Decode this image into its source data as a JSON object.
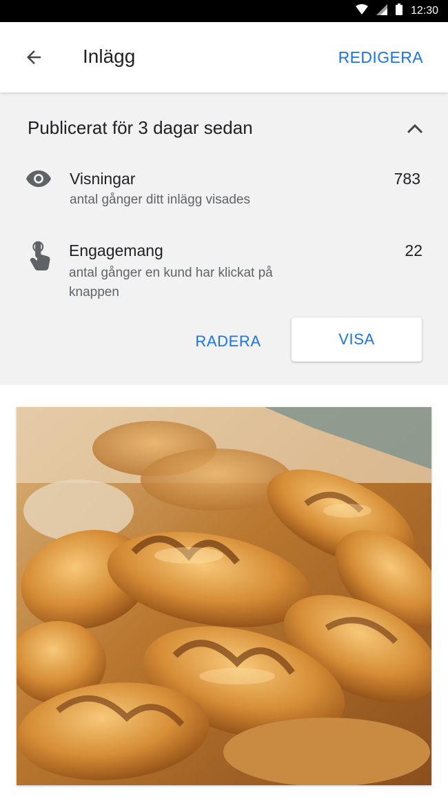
{
  "status_bar": {
    "time": "12:30",
    "icons": [
      "wifi-icon",
      "cell-signal-icon",
      "battery-icon"
    ]
  },
  "app_bar": {
    "back_icon": "arrow-back-icon",
    "title": "Inlägg",
    "edit_label": "REDIGERA"
  },
  "post_info": {
    "published": "Publicerat för 3 dagar sedan",
    "collapse_icon": "chevron-up-icon",
    "stats": [
      {
        "icon": "eye-icon",
        "title": "Visningar",
        "description": "antal gånger ditt inlägg visades",
        "value": "783"
      },
      {
        "icon": "touch-hand-icon",
        "title": "Engagemang",
        "description_line1": "antal gånger en kund har klickat på",
        "description_line2": "knappen",
        "value": "22"
      }
    ],
    "actions": {
      "delete_label": "RADERA",
      "view_label": "VISA"
    }
  },
  "post_image": {
    "subject": "croissants-photo"
  },
  "colors": {
    "accent": "#1a73e8",
    "panel_background": "#f2f2f2",
    "status_bar": "#000000"
  }
}
